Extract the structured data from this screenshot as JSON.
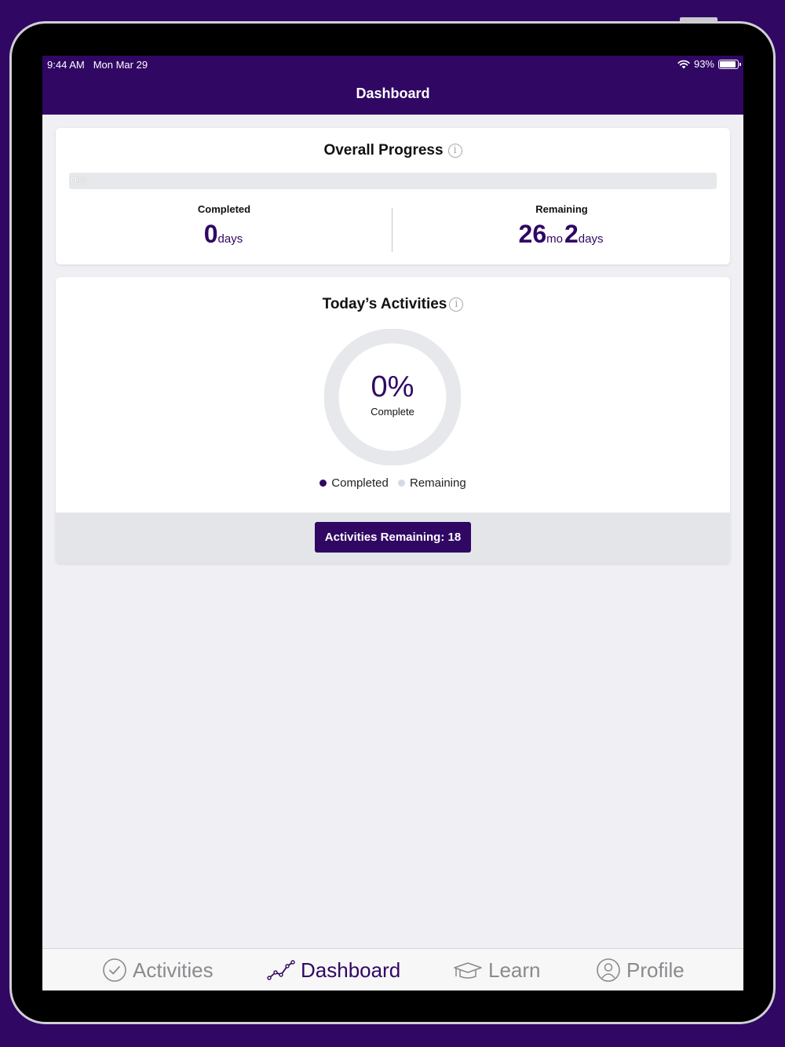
{
  "status_bar": {
    "time": "9:44 AM",
    "date": "Mon Mar 29",
    "battery": "93%",
    "battery_level": 0.93
  },
  "nav": {
    "title": "Dashboard"
  },
  "overall_progress": {
    "title": "Overall Progress",
    "percent_label": "0%",
    "fraction": 0,
    "completed": {
      "label": "Completed",
      "value": "0",
      "unit": "days"
    },
    "remaining": {
      "label": "Remaining",
      "months": "26",
      "months_unit": "mo",
      "days": "2",
      "days_unit": "days"
    }
  },
  "todays_activities": {
    "title": "Today’s Activities",
    "percent": "0%",
    "caption": "Complete",
    "fraction": 0,
    "legend": [
      {
        "label": "Completed",
        "color": "#300763"
      },
      {
        "label": "Remaining",
        "color": "#d3dae5"
      }
    ],
    "button_label": "Activities Remaining: 18"
  },
  "tabs": [
    {
      "label": "Activities",
      "icon": "check-circle-icon"
    },
    {
      "label": "Dashboard",
      "icon": "line-chart-icon",
      "active": true
    },
    {
      "label": "Learn",
      "icon": "graduation-cap-icon"
    },
    {
      "label": "Profile",
      "icon": "person-circle-icon"
    }
  ],
  "colors": {
    "brand": "#300763",
    "track": "#e7e8eb",
    "inactive_tab": "#8a8a8f"
  }
}
